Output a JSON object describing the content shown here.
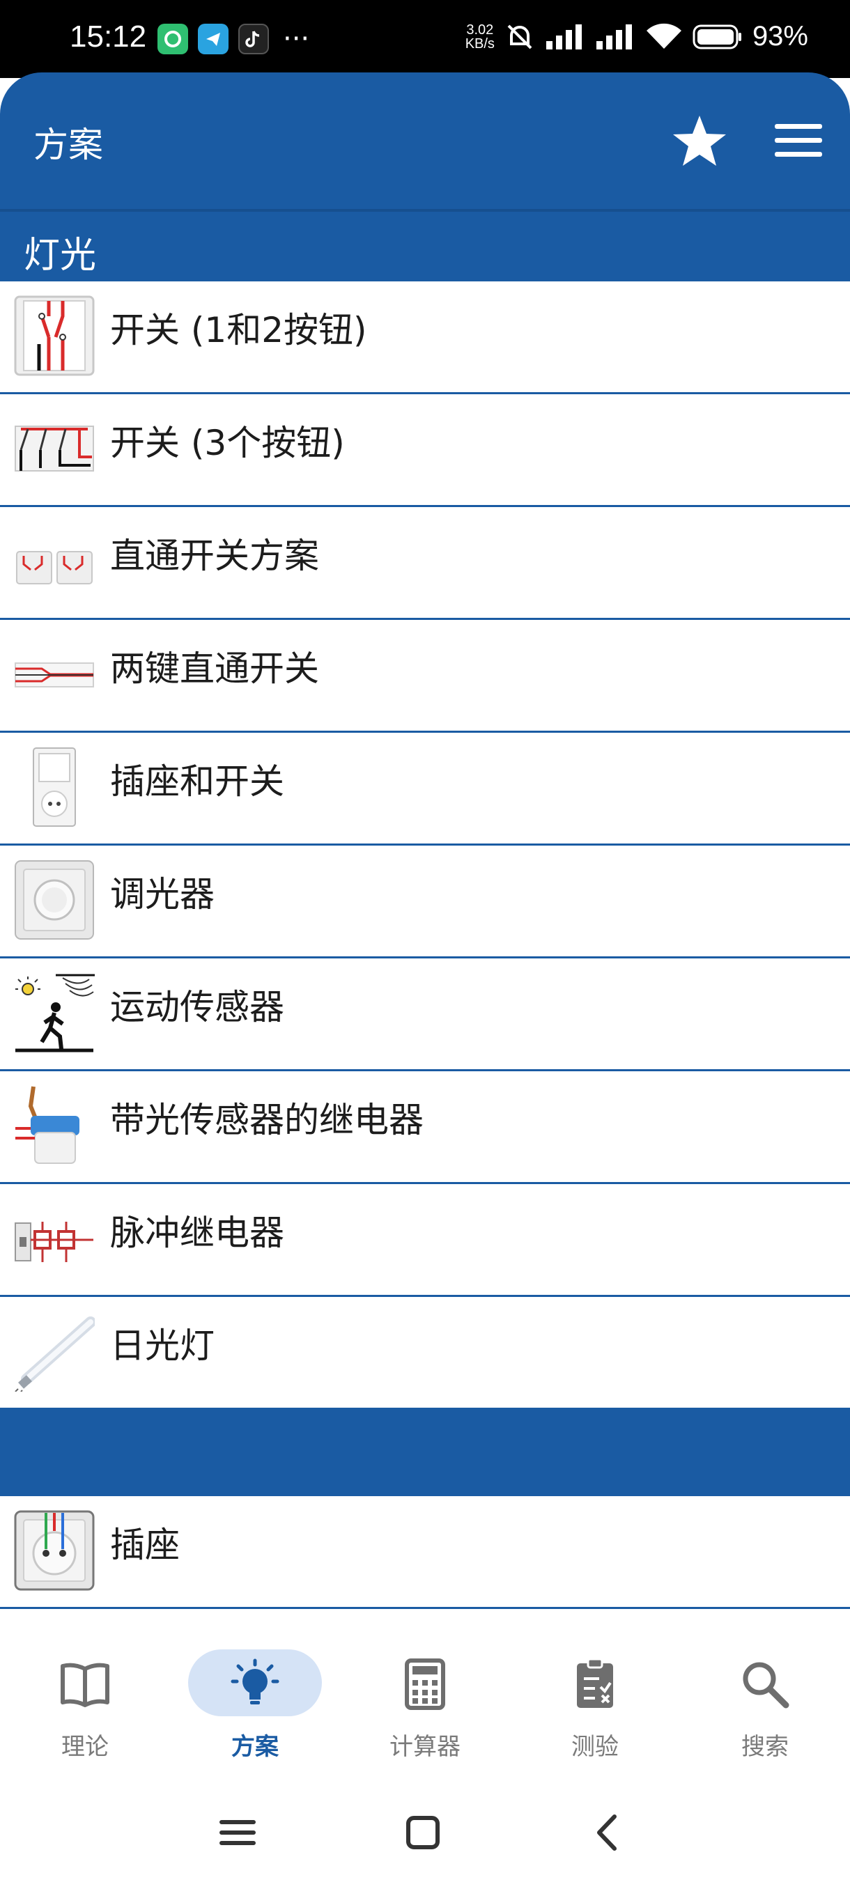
{
  "status_bar": {
    "time": "15:12",
    "more": "···",
    "net_speed_value": "3.02",
    "net_speed_unit": "KB/s",
    "battery": "93%"
  },
  "app_bar": {
    "title": "方案",
    "star_icon": "star-icon",
    "menu_icon": "hamburger-menu-icon",
    "accent_color": "#1a5ba3"
  },
  "sections": {
    "lights": {
      "title": "灯光"
    },
    "second": {
      "title": ""
    }
  },
  "list_items": [
    {
      "label": "开关 (1和2按钮)",
      "icon": "switch-1-2-diagram-icon"
    },
    {
      "label": "开关 (3个按钮)",
      "icon": "switch-3-diagram-icon"
    },
    {
      "label": "直通开关方案",
      "icon": "pass-through-switch-icon"
    },
    {
      "label": "两键直通开关",
      "icon": "two-key-pass-through-switch-icon"
    },
    {
      "label": "插座和开关",
      "icon": "socket-and-switch-icon"
    },
    {
      "label": "调光器",
      "icon": "dimmer-icon"
    },
    {
      "label": "运动传感器",
      "icon": "motion-sensor-icon"
    },
    {
      "label": "带光传感器的继电器",
      "icon": "light-sensor-relay-icon"
    },
    {
      "label": "脉冲继电器",
      "icon": "pulse-relay-icon"
    },
    {
      "label": "日光灯",
      "icon": "fluorescent-lamp-icon"
    },
    {
      "label": "插座",
      "icon": "socket-icon"
    }
  ],
  "bottom_nav": [
    {
      "label": "理论",
      "icon": "book-icon",
      "active": false
    },
    {
      "label": "方案",
      "icon": "lightbulb-icon",
      "active": true
    },
    {
      "label": "计算器",
      "icon": "calculator-icon",
      "active": false
    },
    {
      "label": "测验",
      "icon": "clipboard-check-icon",
      "active": false
    },
    {
      "label": "搜索",
      "icon": "search-icon",
      "active": false
    }
  ],
  "system_nav": [
    "recent-apps-icon",
    "home-icon",
    "back-icon"
  ]
}
